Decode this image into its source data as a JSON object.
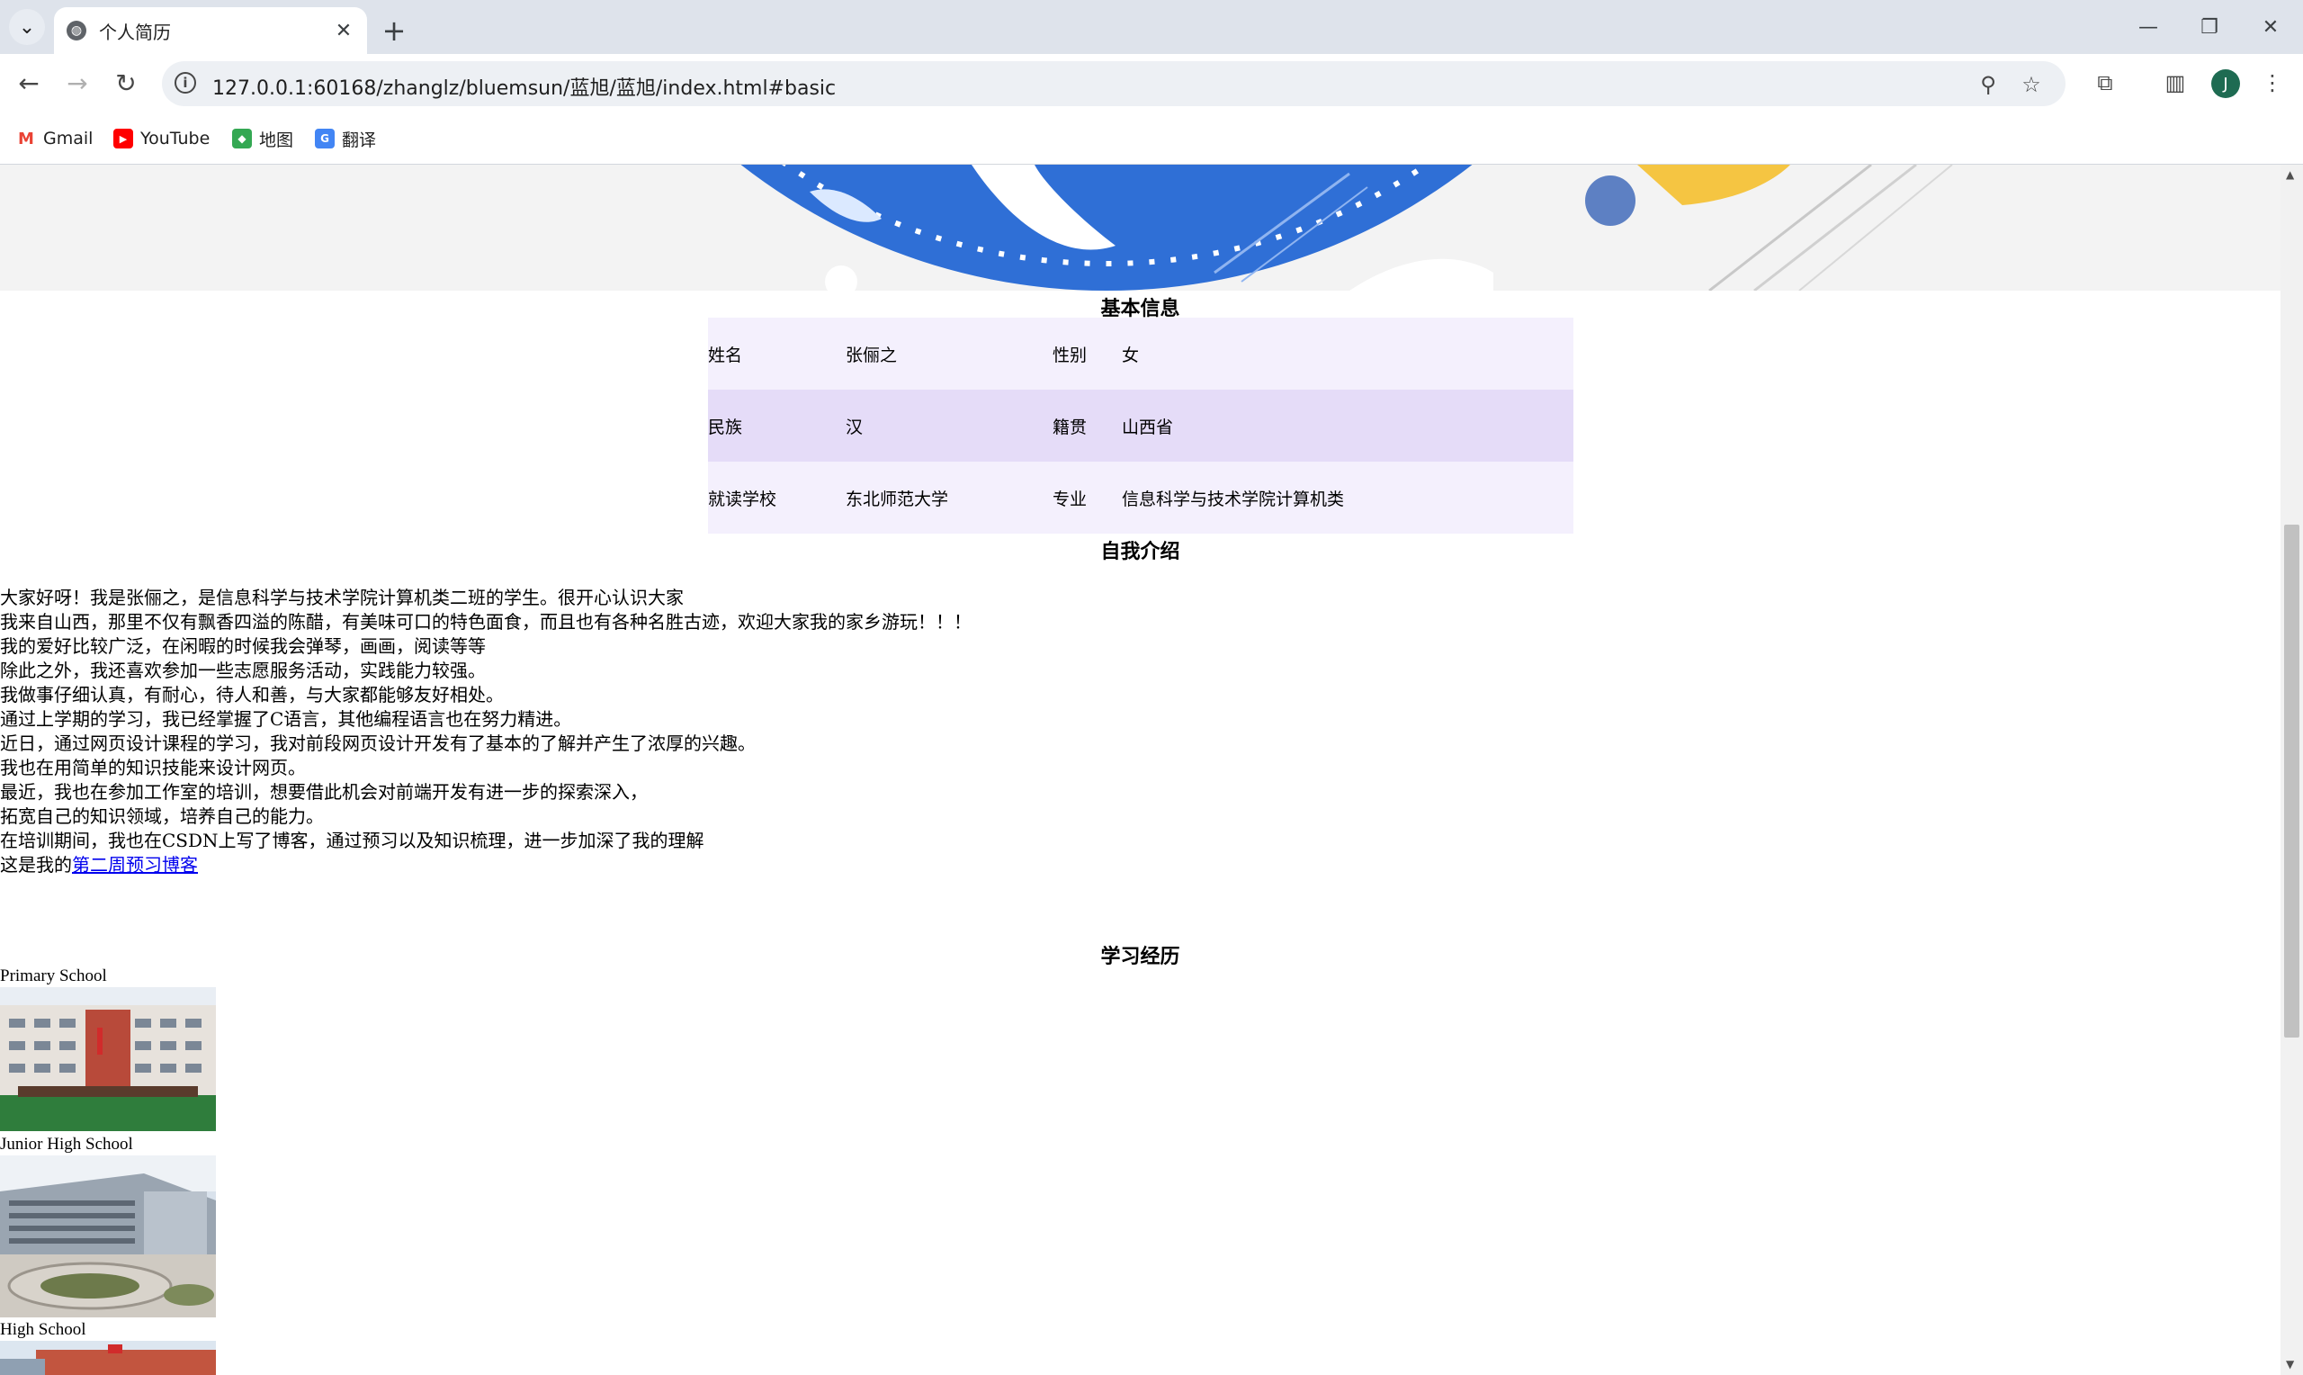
{
  "browser": {
    "tab_title": "个人简历",
    "url": "127.0.0.1:60168/zhanglz/bluemsun/蓝旭/蓝旭/index.html#basic",
    "avatar_letter": "J",
    "bookmarks": [
      {
        "label": "Gmail",
        "icon": "gmail-icon",
        "color": "#ea4335"
      },
      {
        "label": "YouTube",
        "icon": "youtube-icon",
        "color": "#ff0000"
      },
      {
        "label": "地图",
        "icon": "maps-icon",
        "color": "#34a853"
      },
      {
        "label": "翻译",
        "icon": "translate-icon",
        "color": "#4285f4"
      }
    ]
  },
  "page": {
    "basic_info_title": "基本信息",
    "basic_info": [
      [
        "姓名",
        "张俪之",
        "性别",
        "女"
      ],
      [
        "民族",
        "汉",
        "籍贯",
        "山西省"
      ],
      [
        "就读学校",
        "东北师范大学",
        "专业",
        "信息科学与技术学院计算机类"
      ]
    ],
    "intro_title": "自我介绍",
    "intro_lines": [
      "大家好呀！我是张俪之，是信息科学与技术学院计算机类二班的学生。很开心认识大家",
      "我来自山西，那里不仅有飘香四溢的陈醋，有美味可口的特色面食，而且也有各种名胜古迹，欢迎大家我的家乡游玩！！！",
      "我的爱好比较广泛，在闲暇的时候我会弹琴，画画，阅读等等",
      "除此之外，我还喜欢参加一些志愿服务活动，实践能力较强。",
      "我做事仔细认真，有耐心，待人和善，与大家都能够友好相处。",
      "通过上学期的学习，我已经掌握了C语言，其他编程语言也在努力精进。",
      "近日，通过网页设计课程的学习，我对前段网页设计开发有了基本的了解并产生了浓厚的兴趣。",
      "我也在用简单的知识技能来设计网页。",
      "最近，我也在参加工作室的培训，想要借此机会对前端开发有进一步的探索深入，",
      "拓宽自己的知识领域，培养自己的能力。",
      "在培训期间，我也在CSDN上写了博客，通过预习以及知识梳理，进一步加深了我的理解"
    ],
    "blog_prefix": "这是我的",
    "blog_link": "第二周预习博客",
    "study_title": "学习经历",
    "schools": [
      "Primary School",
      "Junior High School",
      "High School"
    ]
  }
}
